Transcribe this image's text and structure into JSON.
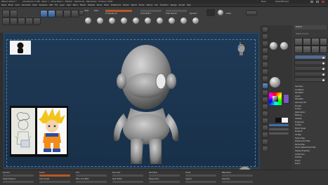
{
  "titlebar": {
    "app": "ZBrush 2022.0.7",
    "info": "ActivePoints: 5,258  ·  Mesh: 1  ·  Active Mesh 1  ·  ZSketch  ·  Total Points  ·  ZRemesher  ·  Timeline: 0.000",
    "menu_label": "Menu",
    "script_label": "DefaultZScript"
  },
  "menu": {
    "items": [
      "Alpha",
      "Brush",
      "Color",
      "Document",
      "Draw",
      "Dynamics",
      "Edit",
      "File",
      "Layer",
      "Light",
      "Macro",
      "Marker",
      "Material",
      "Movie",
      "Picker",
      "Preferences",
      "Render",
      "Stencil",
      "Stroke",
      "Texture",
      "Tool",
      "Transform",
      "Zplugin",
      "Zscript",
      "Help"
    ]
  },
  "toolbar": {
    "home_label": "Home",
    "lightbox_label": "LightBox",
    "live_boolean_label": "Live Boolean",
    "edit_label": "Edit",
    "draw_label": "Draw",
    "move_label": "Move",
    "scale_label": "Scale",
    "rotate_label": "Rotate",
    "mrgb_label": "Mrgb",
    "rgb_label": "Rgb",
    "m_label": "M",
    "zadd_label": "Zadd",
    "zsub_label": "Zsub",
    "zintensity_label": "Z Intensity 25",
    "focal_label": "Focal Shift 0",
    "draw_size_label": "Draw Size 64",
    "dynamic_label": "Dynamic",
    "polish_label": "Polish"
  },
  "subtools_panel": {
    "title": "Subtool",
    "visible_count": "Visible Count 8"
  },
  "right_panel": {
    "rows": [
      "Geometry",
      "ArrayMesh",
      "NanoMesh",
      "Layers",
      "FiberMesh",
      "Geometry HD",
      "Preview",
      "Surface",
      "Deformation",
      "Masking",
      "Visibility",
      "Polygroups",
      "Contact",
      "Morph Target",
      "Polypaint",
      "UV Map",
      "Texture Map",
      "Displacement Map",
      "Normal Map",
      "Vector Displacement Map",
      "Display Properties",
      "Unified Skin",
      "Initialize",
      "Import",
      "Export"
    ]
  },
  "bottom": {
    "labels": [
      "Dynamic",
      "Subdiv",
      "Smt",
      "Del Lower",
      "Del Higher",
      "Divide",
      "ZRemesher",
      "Target Polygons",
      "Auto Groups",
      "Mirror And Weld",
      "Split Hidden",
      "Merge Down",
      "Append",
      "Duplicate"
    ]
  },
  "colors": {
    "canvas": "#1f3a57",
    "accent": "#b8572a",
    "blue": "#3f6ea8",
    "model": "#8e8e8e"
  }
}
